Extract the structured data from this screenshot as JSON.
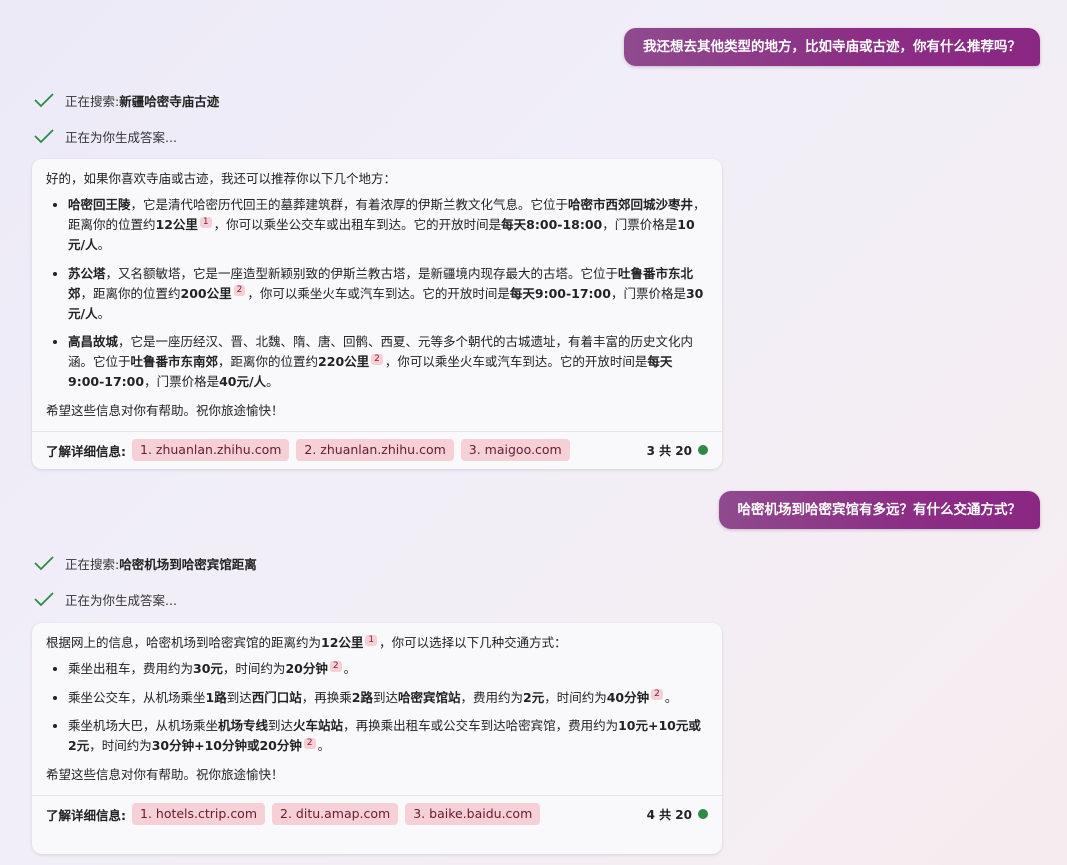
{
  "conversation": {
    "turn1": {
      "user_message": "我还想去其他类型的地方，比如寺庙或古迹，你有什么推荐吗？",
      "search_prefix": "正在搜索: ",
      "search_query": "新疆哈密寺庙古迹",
      "generating": "正在为你生成答案...",
      "intro": "好的，如果你喜欢寺庙或古迹，我还可以推荐你以下几个地方：",
      "items": [
        {
          "name": "哈密回王陵",
          "t1": "，它是清代哈密历代回王的墓葬建筑群，有着浓厚的伊斯兰教文化气息。它位于",
          "loc": "哈密市西郊回城沙枣井",
          "t2": "，距离你的位置约",
          "dist": "12公里",
          "ref": "1",
          "t3": "，你可以乘坐公交车或出租车到达。它的开放时间是",
          "hours": "每天8:00-18:00",
          "t4": "，门票价格是",
          "price": "10元/人",
          "t5": "。"
        },
        {
          "name": "苏公塔",
          "t1": "，又名额敏塔，它是一座造型新颖别致的伊斯兰教古塔，是新疆境内现存最大的古塔。它位于",
          "loc": "吐鲁番市东北郊",
          "t2": "，距离你的位置约",
          "dist": "200公里",
          "ref": "2",
          "t3": "，你可以乘坐火车或汽车到达。它的开放时间是",
          "hours": "每天9:00-17:00",
          "t4": "，门票价格是",
          "price": "30元/人",
          "t5": "。"
        },
        {
          "name": "高昌故城",
          "t1": "，它是一座历经汉、晋、北魏、隋、唐、回鹘、西夏、元等多个朝代的古城遗址，有着丰富的历史文化内涵。它位于",
          "loc": "吐鲁番市东南郊",
          "t2": "，距离你的位置约",
          "dist": "220公里",
          "ref": "2",
          "t3": "，你可以乘坐火车或汽车到达。它的开放时间是",
          "hours": "每天9:00-17:00",
          "t4": "，门票价格是",
          "price": "40元/人",
          "t5": "。"
        }
      ],
      "closing": "希望这些信息对你有帮助。祝你旅途愉快！",
      "learn_more": "了解详细信息:",
      "sources": [
        "1. zhuanlan.zhihu.com",
        "2. zhuanlan.zhihu.com",
        "3. maigoo.com"
      ],
      "count": "3 共 20"
    },
    "turn2": {
      "user_message": "哈密机场到哈密宾馆有多远？有什么交通方式？",
      "search_prefix": "正在搜索: ",
      "search_query": "哈密机场到哈密宾馆距离",
      "generating": "正在为你生成答案...",
      "intro_a": "根据网上的信息，哈密机场到哈密宾馆的距离约为",
      "intro_dist": "12公里",
      "intro_ref": "1",
      "intro_b": "，你可以选择以下几种交通方式：",
      "taxi": {
        "t1": "乘坐出租车，费用约为",
        "fee": "30元",
        "t2": "，时间约为",
        "time": "20分钟",
        "ref": "2",
        "t3": "。"
      },
      "bus": {
        "t1": "乘坐公交车，从机场乘坐",
        "route1": "1路",
        "t2": "到达",
        "stop1": "西门口站",
        "t3": "，再换乘",
        "route2": "2路",
        "t4": "到达",
        "stop2": "哈密宾馆站",
        "t5": "，费用约为",
        "fee": "2元",
        "t6": "，时间约为",
        "time": "40分钟",
        "ref": "2",
        "t7": "。"
      },
      "shuttle": {
        "t1": "乘坐机场大巴，从机场乘坐",
        "line": "机场专线",
        "t2": "到达",
        "stop": "火车站站",
        "t3": "，再换乘出租车或公交车到达哈密宾馆，费用约为",
        "fee": "10元+10元或2元",
        "t4": "，时间约为",
        "time": "30分钟+10分钟或20分钟",
        "ref": "2",
        "t5": "。"
      },
      "closing": "希望这些信息对你有帮助。祝你旅途愉快！",
      "learn_more": "了解详细信息:",
      "sources": [
        "1. hotels.ctrip.com",
        "2. ditu.amap.com",
        "3. baike.baidu.com"
      ],
      "count": "4 共 20"
    }
  },
  "icons": {
    "check": "checkmark-icon",
    "status_dot": "status-dot-icon"
  },
  "colors": {
    "user_bubble": "#8c2f85",
    "chip_bg": "#f5d0d6",
    "check": "#2f8a4a",
    "status_dot": "#2f8a4a"
  }
}
